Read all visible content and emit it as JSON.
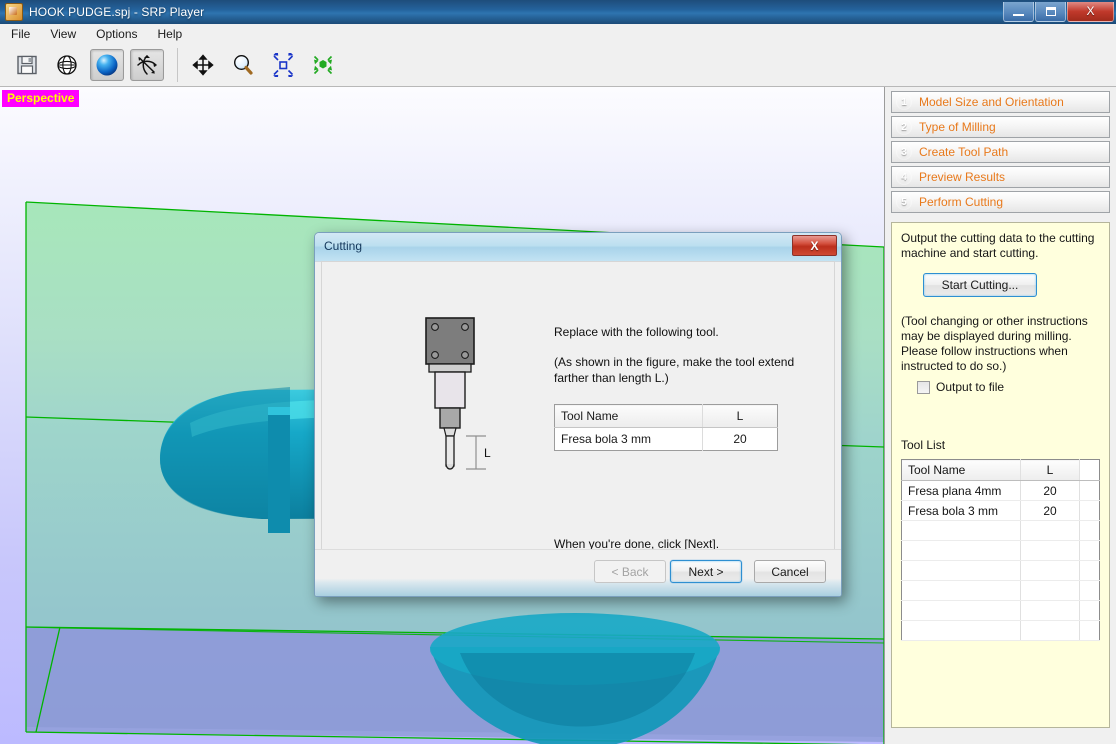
{
  "window": {
    "title": "HOOK PUDGE.spj - SRP Player",
    "app_icon": "srp-player-icon",
    "minimize_label": "Minimize",
    "maximize_label": "Maximize",
    "close_label": "X"
  },
  "menubar": {
    "items": [
      {
        "label": "File",
        "name": "menu-file"
      },
      {
        "label": "View",
        "name": "menu-view"
      },
      {
        "label": "Options",
        "name": "menu-options"
      },
      {
        "label": "Help",
        "name": "menu-help"
      }
    ]
  },
  "toolbar": {
    "buttons": [
      {
        "icon": "save-icon",
        "name": "toolbar-save",
        "pressed": false
      },
      {
        "icon": "globe-icon",
        "name": "toolbar-globe",
        "pressed": false
      },
      {
        "icon": "sphere-shading-icon",
        "name": "toolbar-shading",
        "pressed": true
      },
      {
        "icon": "rotate-icon",
        "name": "toolbar-rotate",
        "pressed": true
      },
      {
        "icon": "pan-move-icon",
        "name": "toolbar-pan",
        "pressed": false
      },
      {
        "icon": "magnifier-zoom-icon",
        "name": "toolbar-zoom",
        "pressed": false
      },
      {
        "icon": "zoom-extents-icon",
        "name": "toolbar-zoom-extents",
        "pressed": false
      },
      {
        "icon": "fit-cube-icon",
        "name": "toolbar-fit-view",
        "pressed": false
      }
    ]
  },
  "viewport": {
    "perspective_label": "Perspective",
    "perspective_bg": "#ff00ff",
    "perspective_fg": "#ffff00",
    "model_color": "#18a6c4",
    "block_outline_color": "#00b400",
    "block_top_color": "#a6e6b9",
    "block_bottom_color": "#8a9ad6"
  },
  "dialog": {
    "title": "Cutting",
    "close_label": "X",
    "instruction_1": "Replace with the following tool.",
    "instruction_2": "(As shown in the figure, make the tool extend farther than length L.)",
    "instruction_3": "When you're done, click [Next].",
    "figure_label_l": "L",
    "tool_table": {
      "headers": [
        "Tool Name",
        "L"
      ],
      "rows": [
        {
          "name": "Fresa bola 3 mm",
          "l": "20"
        }
      ]
    },
    "buttons": {
      "back": "< Back",
      "next": "Next >",
      "cancel": "Cancel"
    }
  },
  "sidebar": {
    "steps": [
      {
        "num": "1",
        "label": "Model Size and Orientation"
      },
      {
        "num": "2",
        "label": "Type of Milling"
      },
      {
        "num": "3",
        "label": "Create Tool Path"
      },
      {
        "num": "4",
        "label": "Preview Results"
      },
      {
        "num": "5",
        "label": "Perform Cutting"
      }
    ],
    "panel": {
      "description": "Output the cutting data to the cutting machine and start cutting.",
      "start_button": "Start Cutting...",
      "note": "(Tool changing or other instructions may be displayed during milling. Please follow instructions when instructed to do so.)",
      "output_to_file_label": "Output to file",
      "output_to_file_checked": false,
      "tool_list_label": "Tool List",
      "tool_table": {
        "headers": [
          "Tool Name",
          "L"
        ],
        "rows": [
          {
            "name": "Fresa plana 4mm",
            "l": "20"
          },
          {
            "name": "Fresa bola 3 mm",
            "l": "20"
          }
        ],
        "empty_rows": 6
      }
    },
    "accent_color": "#e8791b",
    "panel_bg": "#ffffdd"
  }
}
